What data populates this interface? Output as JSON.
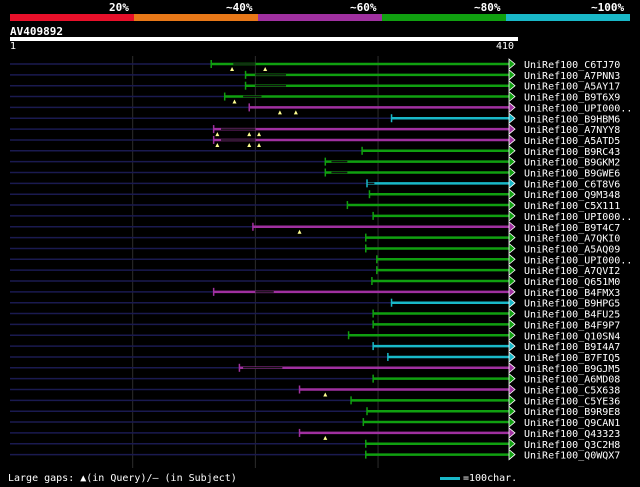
{
  "legend": {
    "labels": [
      "20%",
      "~40%",
      "~60%",
      "~80%",
      "~100%"
    ],
    "colors": [
      "#e8102a",
      "#e87818",
      "#a030a0",
      "#10a010",
      "#19b8c8"
    ]
  },
  "query": {
    "name": "AV409892",
    "start_label": "1",
    "end_label": "410",
    "length": 410
  },
  "footer": {
    "gaps_text": "Large gaps: ▲(in Query)/– (in Subject)",
    "scale_text": "=100char."
  },
  "hits": [
    {
      "name": "UniRef100_C6TJ70",
      "start": 164,
      "end": 410,
      "color": "green",
      "qgaps": [
        181,
        208
      ],
      "sgap": [
        182,
        200
      ]
    },
    {
      "name": "UniRef100_A7PNN3",
      "start": 192,
      "end": 410,
      "color": "green",
      "qgaps": [],
      "sgap": [
        200,
        225
      ]
    },
    {
      "name": "UniRef100_A5AY17",
      "start": 192,
      "end": 410,
      "color": "green",
      "qgaps": [],
      "sgap": [
        200,
        225
      ]
    },
    {
      "name": "UniRef100_B9T6X9",
      "start": 175,
      "end": 410,
      "color": "green",
      "qgaps": [
        183
      ],
      "sgap": [
        190,
        205
      ]
    },
    {
      "name": "UniRef100_UPI000..",
      "start": 195,
      "end": 410,
      "color": "purple",
      "qgaps": [
        220,
        233
      ],
      "sgap": []
    },
    {
      "name": "UniRef100_B9HBM6",
      "start": 311,
      "end": 410,
      "color": "teal",
      "qgaps": [],
      "sgap": []
    },
    {
      "name": "UniRef100_A7NYY8",
      "start": 166,
      "end": 410,
      "color": "purple",
      "qgaps": [
        169,
        195,
        203
      ],
      "sgap": [
        172,
        200
      ]
    },
    {
      "name": "UniRef100_A5ATD5",
      "start": 166,
      "end": 410,
      "color": "purple",
      "qgaps": [
        169,
        195,
        203
      ],
      "sgap": [
        172,
        200
      ]
    },
    {
      "name": "UniRef100_B9RC43",
      "start": 287,
      "end": 410,
      "color": "green",
      "qgaps": [],
      "sgap": []
    },
    {
      "name": "UniRef100_B9GKM2",
      "start": 257,
      "end": 410,
      "color": "green",
      "qgaps": [],
      "sgap": [
        262,
        275
      ]
    },
    {
      "name": "UniRef100_B9GWE6",
      "start": 257,
      "end": 410,
      "color": "green",
      "qgaps": [],
      "sgap": [
        262,
        275
      ]
    },
    {
      "name": "UniRef100_C6T8V6",
      "start": 291,
      "end": 410,
      "color": "teal",
      "qgaps": [],
      "sgap": [
        291,
        297
      ]
    },
    {
      "name": "UniRef100_Q9M348",
      "start": 293,
      "end": 410,
      "color": "green",
      "qgaps": [],
      "sgap": []
    },
    {
      "name": "UniRef100_C5X111",
      "start": 275,
      "end": 410,
      "color": "green",
      "qgaps": [],
      "sgap": []
    },
    {
      "name": "UniRef100_UPI000..",
      "start": 296,
      "end": 410,
      "color": "green",
      "qgaps": [],
      "sgap": []
    },
    {
      "name": "UniRef100_B9T4C7",
      "start": 198,
      "end": 410,
      "color": "purple",
      "qgaps": [
        236
      ],
      "sgap": []
    },
    {
      "name": "UniRef100_A7QKI0",
      "start": 290,
      "end": 410,
      "color": "green",
      "qgaps": [],
      "sgap": []
    },
    {
      "name": "UniRef100_A5AQ09",
      "start": 290,
      "end": 410,
      "color": "green",
      "qgaps": [],
      "sgap": []
    },
    {
      "name": "UniRef100_UPI000..",
      "start": 299,
      "end": 410,
      "color": "green",
      "qgaps": [],
      "sgap": []
    },
    {
      "name": "UniRef100_A7QVI2",
      "start": 299,
      "end": 410,
      "color": "green",
      "qgaps": [],
      "sgap": []
    },
    {
      "name": "UniRef100_Q651M0",
      "start": 295,
      "end": 410,
      "color": "green",
      "qgaps": [],
      "sgap": []
    },
    {
      "name": "UniRef100_B4FMX3",
      "start": 166,
      "end": 410,
      "color": "purple",
      "qgaps": [],
      "sgap": [
        200,
        215
      ]
    },
    {
      "name": "UniRef100_B9HPG5",
      "start": 311,
      "end": 410,
      "color": "teal",
      "qgaps": [],
      "sgap": []
    },
    {
      "name": "UniRef100_B4FU25",
      "start": 296,
      "end": 410,
      "color": "green",
      "qgaps": [],
      "sgap": []
    },
    {
      "name": "UniRef100_B4F9P7",
      "start": 296,
      "end": 410,
      "color": "green",
      "qgaps": [],
      "sgap": []
    },
    {
      "name": "UniRef100_Q10SN4",
      "start": 276,
      "end": 410,
      "color": "green",
      "qgaps": [],
      "sgap": []
    },
    {
      "name": "UniRef100_B9I4A7",
      "start": 296,
      "end": 410,
      "color": "teal",
      "qgaps": [],
      "sgap": []
    },
    {
      "name": "UniRef100_B7FIQ5",
      "start": 308,
      "end": 410,
      "color": "teal",
      "qgaps": [],
      "sgap": []
    },
    {
      "name": "UniRef100_B9GJM5",
      "start": 187,
      "end": 410,
      "color": "purple",
      "qgaps": [],
      "sgap": [
        190,
        222
      ]
    },
    {
      "name": "UniRef100_A6MD08",
      "start": 296,
      "end": 410,
      "color": "green",
      "qgaps": [],
      "sgap": []
    },
    {
      "name": "UniRef100_C5X638",
      "start": 236,
      "end": 410,
      "color": "purple",
      "qgaps": [
        257
      ],
      "sgap": []
    },
    {
      "name": "UniRef100_C5YE36",
      "start": 278,
      "end": 410,
      "color": "green",
      "qgaps": [],
      "sgap": []
    },
    {
      "name": "UniRef100_B9R9E8",
      "start": 291,
      "end": 410,
      "color": "green",
      "qgaps": [],
      "sgap": []
    },
    {
      "name": "UniRef100_Q9CAN1",
      "start": 288,
      "end": 410,
      "color": "green",
      "qgaps": [],
      "sgap": []
    },
    {
      "name": "UniRef100_Q43323",
      "start": 236,
      "end": 410,
      "color": "purple",
      "qgaps": [
        257
      ],
      "sgap": []
    },
    {
      "name": "UniRef100_Q3C2H8",
      "start": 290,
      "end": 410,
      "color": "green",
      "qgaps": [],
      "sgap": []
    },
    {
      "name": "UniRef100_Q0WQX7",
      "start": 290,
      "end": 410,
      "color": "green",
      "qgaps": [],
      "sgap": []
    }
  ],
  "hit_colors": {
    "green": "#10a010",
    "purple": "#a030a0",
    "teal": "#19b8c8"
  }
}
